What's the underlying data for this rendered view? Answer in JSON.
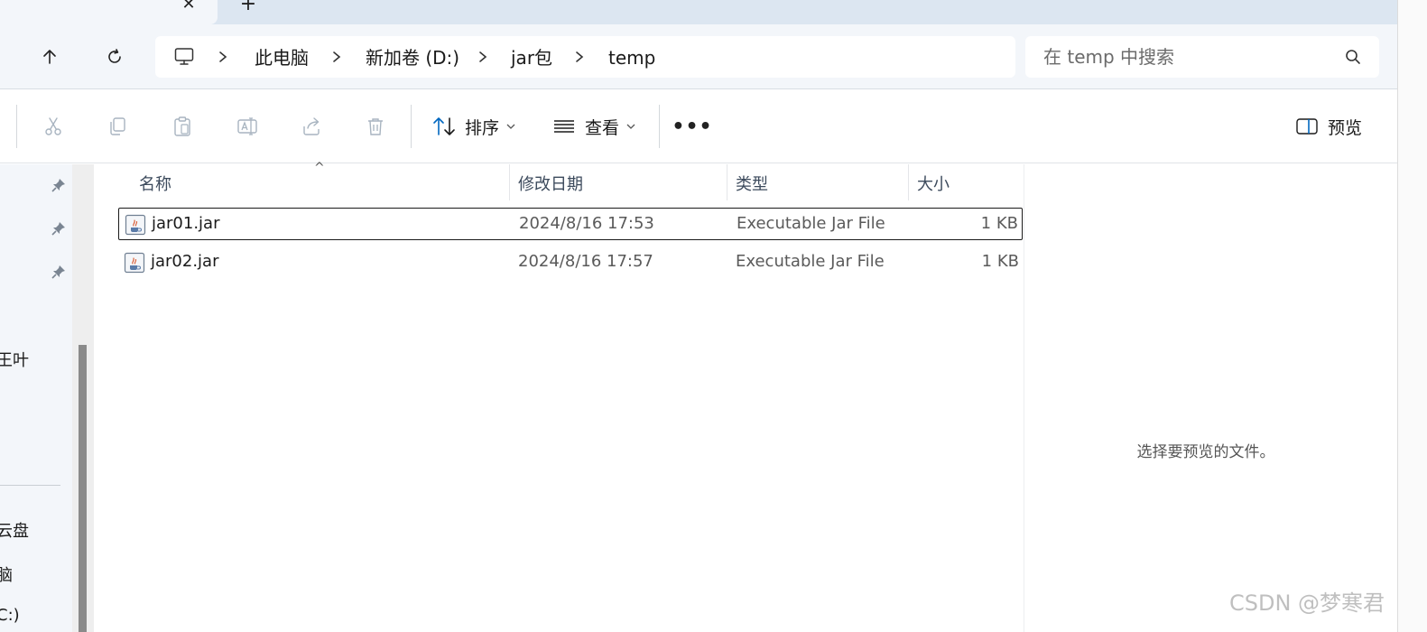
{
  "tabs": {
    "close_glyph": "✕",
    "add_glyph": "+"
  },
  "address": {
    "crumbs": [
      "此电脑",
      "新加卷 (D:)",
      "jar包",
      "temp"
    ]
  },
  "search": {
    "placeholder": "在 temp 中搜索"
  },
  "commandbar": {
    "sort_label": "排序",
    "view_label": "查看",
    "more_label": "•••",
    "preview_label": "预览"
  },
  "navpane": {
    "fragments": [
      "王叶",
      "云盘",
      "脑",
      "C:)"
    ]
  },
  "filelist": {
    "columns": {
      "name": "名称",
      "date": "修改日期",
      "type": "类型",
      "size": "大小"
    },
    "rows": [
      {
        "name": "jar01.jar",
        "date": "2024/8/16 17:53",
        "type": "Executable Jar File",
        "size": "1 KB",
        "selected": true
      },
      {
        "name": "jar02.jar",
        "date": "2024/8/16 17:57",
        "type": "Executable Jar File",
        "size": "1 KB",
        "selected": false
      }
    ]
  },
  "preview": {
    "message": "选择要预览的文件。"
  },
  "watermark": "CSDN @梦寒君",
  "colors": {
    "accent": "#0067c0",
    "disabled_icon": "#a8b4c0",
    "chrome": "#f3f6fa"
  }
}
